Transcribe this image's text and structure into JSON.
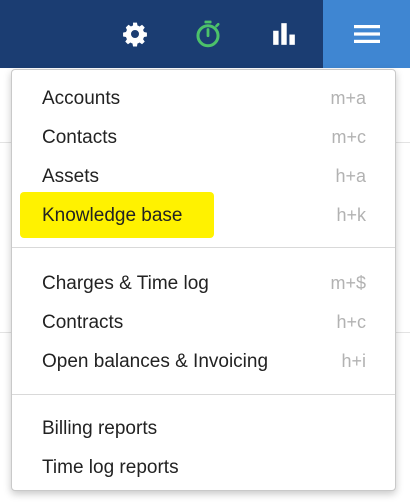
{
  "toolbar": {
    "icons": [
      "gear-icon",
      "stopwatch-icon",
      "bar-chart-icon",
      "hamburger-menu-icon"
    ],
    "colors": {
      "bar": "#1b3d72",
      "active": "#3f86d2",
      "timer": "#4cc26a"
    }
  },
  "menu": {
    "groups": [
      [
        {
          "label": "Accounts",
          "shortcut": "m+a"
        },
        {
          "label": "Contacts",
          "shortcut": "m+c"
        },
        {
          "label": "Assets",
          "shortcut": "h+a"
        },
        {
          "label": "Knowledge base",
          "shortcut": "h+k",
          "highlighted": true
        }
      ],
      [
        {
          "label": "Charges & Time log",
          "shortcut": "m+$"
        },
        {
          "label": "Contracts",
          "shortcut": "h+c"
        },
        {
          "label": "Open balances & Invoicing",
          "shortcut": "h+i"
        }
      ],
      [
        {
          "label": "Billing reports",
          "shortcut": ""
        },
        {
          "label": "Time log reports",
          "shortcut": ""
        }
      ]
    ],
    "highlight_color": "#fff200"
  }
}
